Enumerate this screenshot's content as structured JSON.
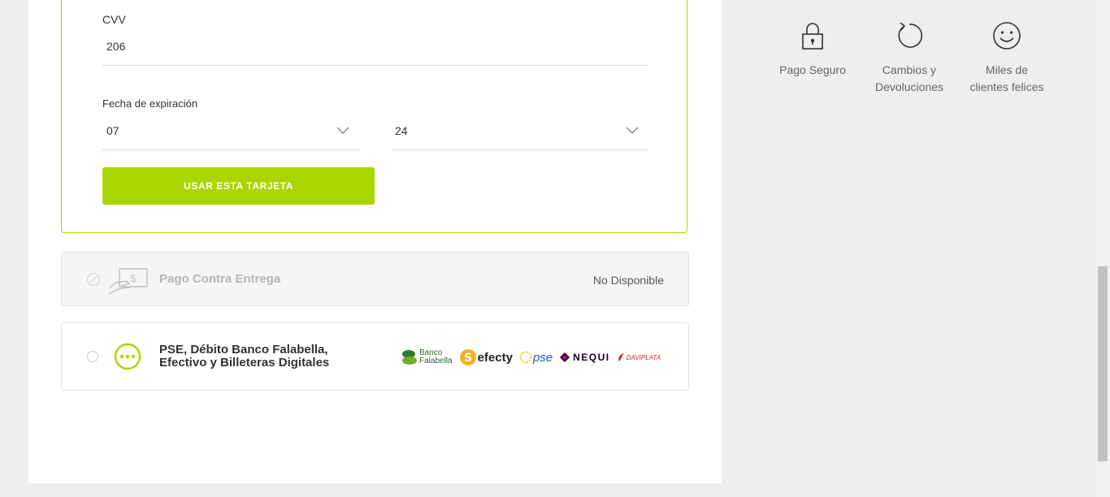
{
  "card_form": {
    "cvv_label": "CVV",
    "cvv_value": "206",
    "expiration_label": "Fecha de expiración",
    "month_value": "07",
    "year_value": "24",
    "use_card_button": "USAR ESTA TARJETA"
  },
  "payment_options": [
    {
      "title": "Pago Contra Entrega",
      "status": "No Disponible",
      "icon": "cash-hand-icon"
    },
    {
      "title_line1": "PSE, Débito Banco Falabella,",
      "title_line2": "Efectivo y Billeteras Digitales",
      "icon": "more-dots-icon",
      "logos": {
        "banco_line1": "Banco",
        "banco_line2": "Falabella",
        "efecty": "efecty",
        "pse": "pse",
        "nequi": "NEQUI",
        "daviplata": "DAVIPLATA"
      }
    }
  ],
  "benefits": [
    {
      "icon": "lock-icon",
      "line1": "Pago Seguro",
      "line2": ""
    },
    {
      "icon": "return-arrow-icon",
      "line1": "Cambios y",
      "line2": "Devoluciones"
    },
    {
      "icon": "smiley-icon",
      "line1": "Miles de",
      "line2": "clientes felices"
    }
  ],
  "colors": {
    "accent": "#aad500",
    "background": "#eeeeee",
    "panel": "#ffffff"
  }
}
